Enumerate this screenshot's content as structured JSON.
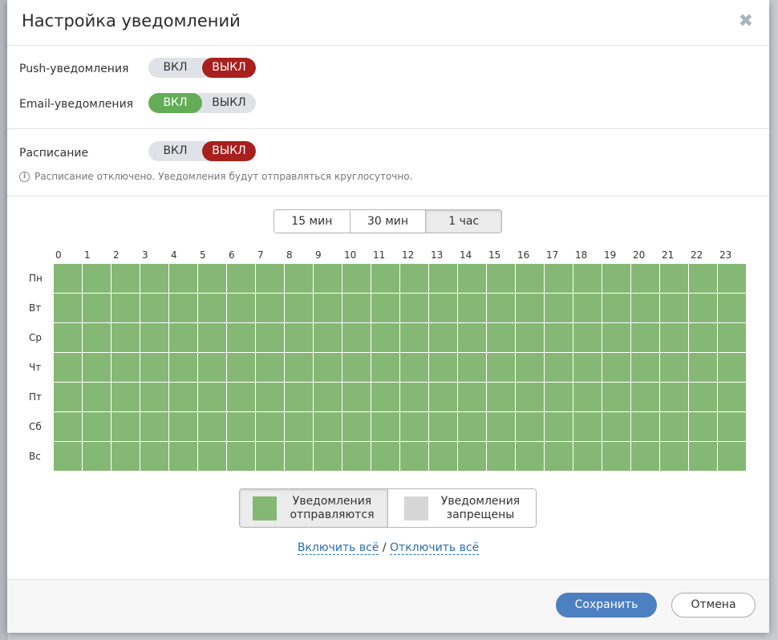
{
  "dialog": {
    "title": "Настройка уведомлений",
    "close_icon": "close-icon"
  },
  "push": {
    "label": "Push-уведомления",
    "on": "ВКЛ",
    "off": "ВЫКЛ",
    "state": "off"
  },
  "email": {
    "label": "Email-уведомления",
    "on": "ВКЛ",
    "off": "ВЫКЛ",
    "state": "on"
  },
  "schedule": {
    "label": "Расписание",
    "on": "ВКЛ",
    "off": "ВЫКЛ",
    "state": "off",
    "note": "Расписание отключено. Уведомления будут отправляться круглосуточно.",
    "info_icon": "info-icon"
  },
  "intervals": {
    "options": [
      "15 мин",
      "30 мин",
      "1 час"
    ],
    "selected": "1 час"
  },
  "grid": {
    "hours": [
      "0",
      "1",
      "2",
      "3",
      "4",
      "5",
      "6",
      "7",
      "8",
      "9",
      "10",
      "11",
      "12",
      "13",
      "14",
      "15",
      "16",
      "17",
      "18",
      "19",
      "20",
      "21",
      "22",
      "23"
    ],
    "days": [
      "Пн",
      "Вт",
      "Ср",
      "Чт",
      "Пт",
      "Сб",
      "Вс"
    ],
    "all_enabled": true
  },
  "legend": {
    "allowed": "Уведомления отправляются",
    "allowed_l1": "Уведомления",
    "allowed_l2": "отправляются",
    "blocked_l1": "Уведомления",
    "blocked_l2": "запрещены",
    "selected": "allowed"
  },
  "links": {
    "enable_all": "Включить всё",
    "separator": "/",
    "disable_all": "Отключить всё"
  },
  "footer": {
    "save": "Сохранить",
    "cancel": "Отмена"
  },
  "colors": {
    "on": "#64ad56",
    "off": "#a8201e",
    "cell_allowed": "#85b874",
    "cell_blocked": "#d6d6d6",
    "primary": "#4d80c1",
    "link": "#2b6fb2"
  }
}
